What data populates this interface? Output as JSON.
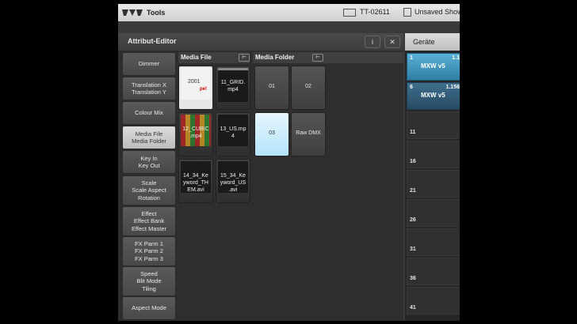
{
  "topbar": {
    "title": "Tools",
    "device": "TT-02611",
    "show": "Unsaved Show"
  },
  "editor": {
    "title": "Attribut-Editor",
    "info_label": "i",
    "close_label": "✕",
    "attributes": [
      {
        "lines": [
          "Dimmer"
        ]
      },
      {
        "lines": [
          "Translation X",
          "Translation Y"
        ]
      },
      {
        "lines": [
          "Colour Mix"
        ]
      },
      {
        "lines": [
          "Media File",
          "Media Folder"
        ],
        "selected": true
      },
      {
        "lines": [
          "Key In",
          "Key Out"
        ]
      },
      {
        "lines": [
          "Scale",
          "Scale Aspect",
          "Rotation"
        ]
      },
      {
        "lines": [
          "Effect",
          "Effect Bank",
          "Effect Master"
        ]
      },
      {
        "lines": [
          "FX Parm 1",
          "FX Parm 2",
          "FX Parm 3"
        ]
      },
      {
        "lines": [
          "Speed",
          "Blit Mode",
          "Tiling"
        ]
      },
      {
        "lines": [
          "Aspect Mode"
        ]
      }
    ],
    "media_file": {
      "title": "Media File",
      "files": [
        {
          "label": "",
          "thumb_text": "2001",
          "thumb_sub": "pe!"
        },
        {
          "label": "11_GRID.\nmp4"
        },
        {
          "label": "12_CUBIC\n.mp4"
        },
        {
          "label": "13_US.mp\n4"
        },
        {
          "label": "14_34_Ke\nyword_TH\nEM.avi"
        },
        {
          "label": "15_34_Ke\nyword_US\n.avi"
        }
      ]
    },
    "media_folder": {
      "title": "Media Folder",
      "folders": [
        {
          "label": "01"
        },
        {
          "label": "02"
        },
        {
          "label": "03",
          "selected": true
        },
        {
          "label": "Raw DMX"
        }
      ]
    }
  },
  "devices": {
    "title": "Geräte",
    "cells": [
      {
        "num": "1",
        "num2": "1.1",
        "name": "MXW v5"
      },
      {
        "num": "6",
        "num2": "1.156",
        "name": "MXW v5"
      },
      {
        "num": "11"
      },
      {
        "num": "16"
      },
      {
        "num": "21"
      },
      {
        "num": "26"
      },
      {
        "num": "31"
      },
      {
        "num": "36"
      },
      {
        "num": "41"
      }
    ]
  }
}
